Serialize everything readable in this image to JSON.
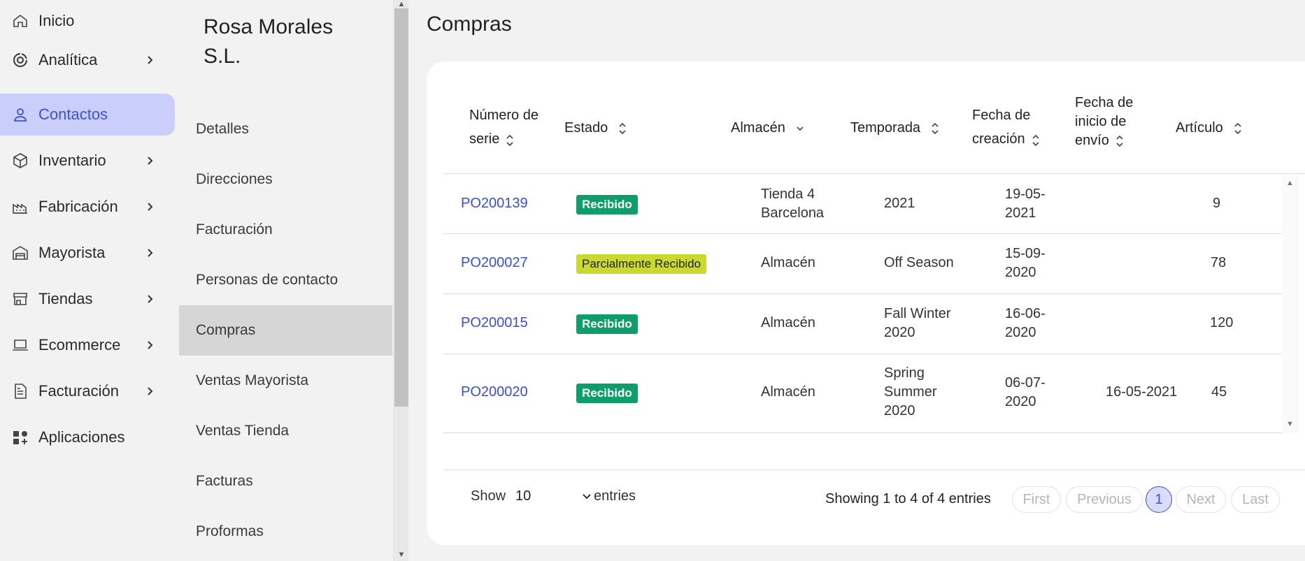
{
  "nav": {
    "items": [
      {
        "label": "Inicio",
        "icon": "home-icon",
        "chevron": false,
        "active": false
      },
      {
        "label": "Analítica",
        "icon": "analytics-icon",
        "chevron": true,
        "active": false
      },
      {
        "label": "Contactos",
        "icon": "user-icon",
        "chevron": false,
        "active": true
      },
      {
        "label": "Inventario",
        "icon": "box-icon",
        "chevron": true,
        "active": false
      },
      {
        "label": "Fabricación",
        "icon": "factory-icon",
        "chevron": true,
        "active": false
      },
      {
        "label": "Mayorista",
        "icon": "warehouse-icon",
        "chevron": true,
        "active": false
      },
      {
        "label": "Tiendas",
        "icon": "store-icon",
        "chevron": true,
        "active": false
      },
      {
        "label": "Ecommerce",
        "icon": "laptop-icon",
        "chevron": true,
        "active": false
      },
      {
        "label": "Facturación",
        "icon": "invoice-icon",
        "chevron": true,
        "active": false
      },
      {
        "label": "Aplicaciones",
        "icon": "apps-icon",
        "chevron": false,
        "active": false
      }
    ]
  },
  "contact": {
    "company_name": "Rosa Morales S.L.",
    "menu": [
      {
        "label": "Detalles",
        "active": false
      },
      {
        "label": "Direcciones",
        "active": false
      },
      {
        "label": "Facturación",
        "active": false
      },
      {
        "label": "Personas de contacto",
        "active": false
      },
      {
        "label": "Compras",
        "active": true
      },
      {
        "label": "Ventas Mayorista",
        "active": false
      },
      {
        "label": "Ventas Tienda",
        "active": false
      },
      {
        "label": "Facturas",
        "active": false
      },
      {
        "label": "Proformas",
        "active": false
      }
    ]
  },
  "main": {
    "title": "Compras",
    "table": {
      "columns": [
        {
          "label": "Número de serie"
        },
        {
          "label": "Estado"
        },
        {
          "label": "Almacén"
        },
        {
          "label": "Temporada"
        },
        {
          "label": "Fecha de creación"
        },
        {
          "label": "Fecha de inicio de envío"
        },
        {
          "label": "Artículo"
        }
      ],
      "rows": [
        {
          "serial": "PO200139",
          "status": "Recibido",
          "status_color": "#0f9e6b",
          "warehouse": "Tienda 4 Barcelona",
          "season": "2021",
          "created": "19-05-2021",
          "ship_start": "",
          "article": "9"
        },
        {
          "serial": "PO200027",
          "status": "Parcialmente Recibido",
          "status_color": "#c9d92e",
          "warehouse": "Almacén",
          "season": "Off Season",
          "created": "15-09-2020",
          "ship_start": "",
          "article": "78"
        },
        {
          "serial": "PO200015",
          "status": "Recibido",
          "status_color": "#0f9e6b",
          "warehouse": "Almacén",
          "season": "Fall Winter 2020",
          "created": "16-06-2020",
          "ship_start": "",
          "article": "120"
        },
        {
          "serial": "PO200020",
          "status": "Recibido",
          "status_color": "#0f9e6b",
          "warehouse": "Almacén",
          "season": "Spring Summer 2020",
          "created": "06-07-2020",
          "ship_start": "16-05-2021",
          "article": "45"
        }
      ]
    },
    "footer": {
      "show_label": "Show",
      "show_value": "10",
      "entries_label": "entries",
      "showing_text": "Showing 1 to 4 of 4 entries",
      "pagination": {
        "first": "First",
        "previous": "Previous",
        "current": "1",
        "next": "Next",
        "last": "Last"
      }
    }
  }
}
